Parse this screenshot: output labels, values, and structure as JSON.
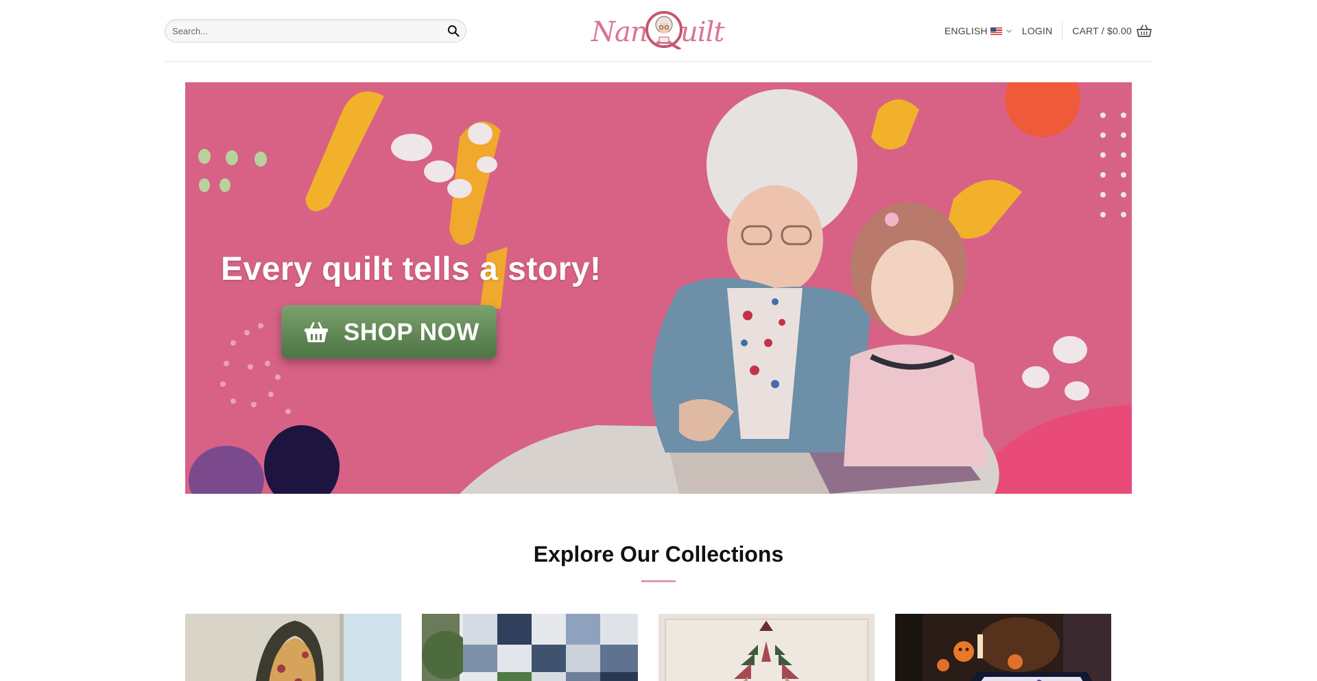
{
  "header": {
    "search_placeholder": "Search...",
    "logo_left": "Nana",
    "logo_right": "uilt",
    "language_label": "ENGLISH",
    "login_label": "LOGIN",
    "cart_label": "CART / $0.00"
  },
  "hero": {
    "title": "Every quilt tells a story!",
    "button_label": "SHOP NOW"
  },
  "collections": {
    "title": "Explore Our Collections"
  },
  "colors": {
    "brand_pink": "#d9758f",
    "hero_bg": "#d76286",
    "button_green": "#5f8554"
  }
}
